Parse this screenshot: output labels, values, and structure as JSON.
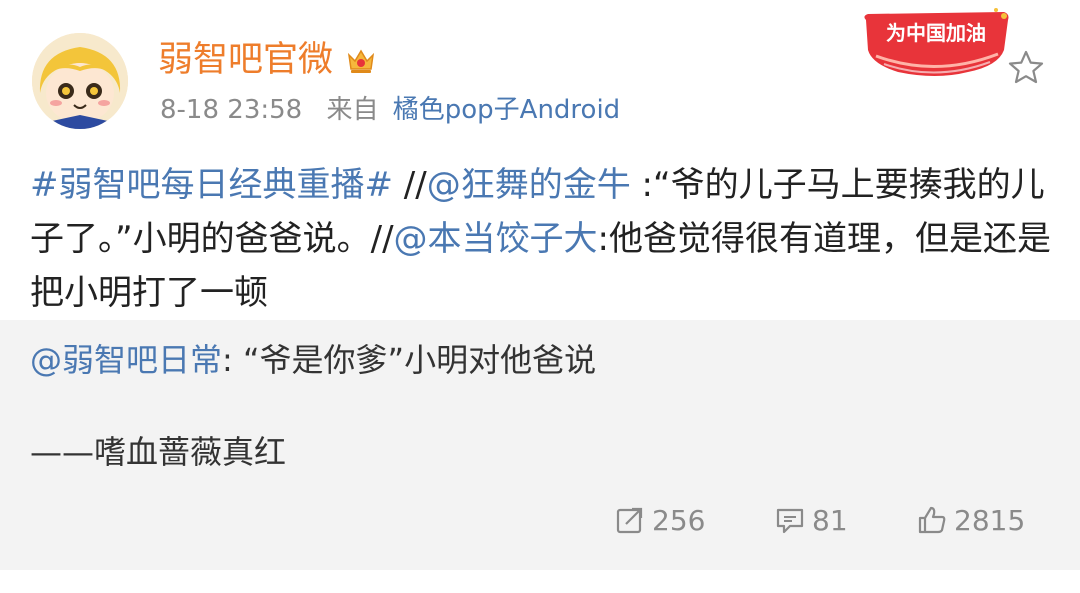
{
  "post": {
    "username": "弱智吧官微",
    "time": "8-18 23:58",
    "from_label": "来自",
    "source": "橘色pop子Android",
    "badge_text": "为中国加油",
    "content": {
      "topic": "#弱智吧每日经典重播#",
      "sep1": " //",
      "mention1": "@狂舞的金牛",
      "text1": " :“爷的儿子马上要揍我的儿子了。”小明的爸爸说。//",
      "mention2": "@本当饺子大",
      "text2": ":他爸觉得很有道理，但是还是把小明打了一顿"
    }
  },
  "retweet": {
    "mention": "@弱智吧日常",
    "text": ": “爷是你爹”小明对他爸说",
    "signature": "——嗜血蔷薇真红"
  },
  "actions": {
    "reposts": "256",
    "comments": "81",
    "likes": "2815"
  },
  "colors": {
    "username": "#ee7d2b",
    "link": "#4a78b2",
    "meta": "#8a8a8a",
    "retweet_bg": "#f3f3f3",
    "badge": "#e8343a"
  },
  "icons": [
    "vip-crown-icon",
    "star-icon",
    "repost-icon",
    "comment-icon",
    "like-icon"
  ]
}
